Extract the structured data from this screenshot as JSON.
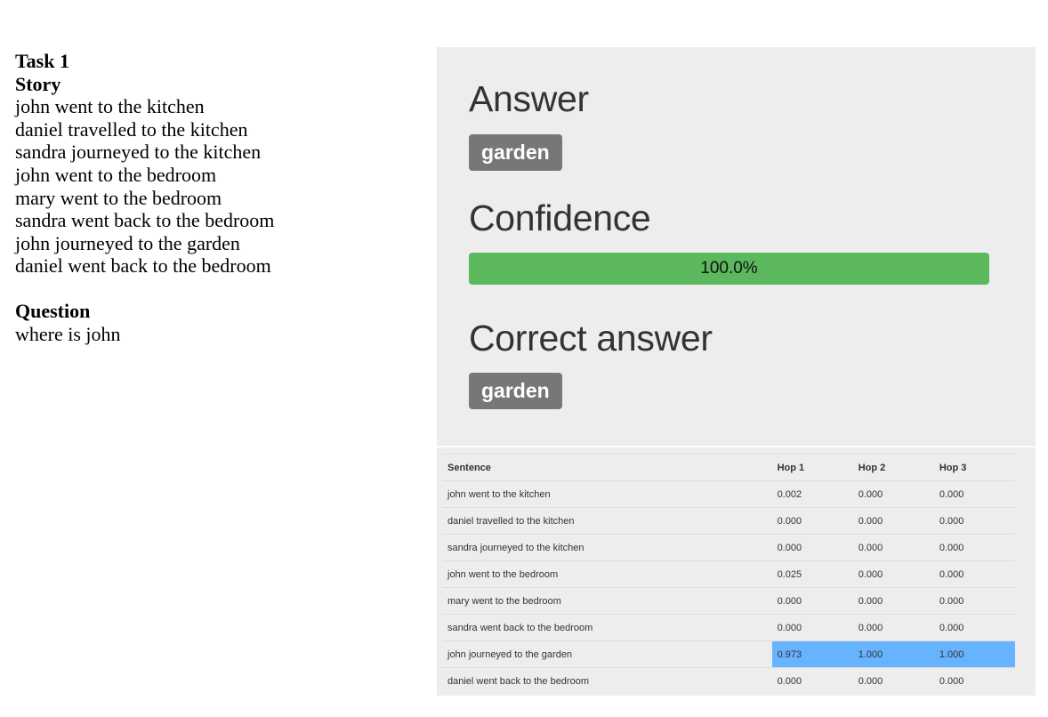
{
  "task": {
    "title": "Task 1",
    "story_heading": "Story",
    "sentences": [
      "john went to the kitchen",
      "daniel travelled to the kitchen",
      "sandra journeyed to the kitchen",
      "john went to the bedroom",
      "mary went to the bedroom",
      "sandra went back to the bedroom",
      "john journeyed to the garden",
      "daniel went back to the bedroom"
    ],
    "question_heading": "Question",
    "question": "where is john"
  },
  "result": {
    "answer_heading": "Answer",
    "answer": "garden",
    "confidence_heading": "Confidence",
    "confidence_text": "100.0%",
    "confidence_value": 100.0,
    "correct_heading": "Correct answer",
    "correct_answer": "garden"
  },
  "colors": {
    "progress": "#5cb85c",
    "highlight": "#66b3ff",
    "badge": "#777777"
  },
  "table": {
    "headers": [
      "Sentence",
      "Hop 1",
      "Hop 2",
      "Hop 3"
    ],
    "rows": [
      {
        "sentence": "john went to the kitchen",
        "hop1": "0.002",
        "hop2": "0.000",
        "hop3": "0.000",
        "highlight": false
      },
      {
        "sentence": "daniel travelled to the kitchen",
        "hop1": "0.000",
        "hop2": "0.000",
        "hop3": "0.000",
        "highlight": false
      },
      {
        "sentence": "sandra journeyed to the kitchen",
        "hop1": "0.000",
        "hop2": "0.000",
        "hop3": "0.000",
        "highlight": false
      },
      {
        "sentence": "john went to the bedroom",
        "hop1": "0.025",
        "hop2": "0.000",
        "hop3": "0.000",
        "highlight": false
      },
      {
        "sentence": "mary went to the bedroom",
        "hop1": "0.000",
        "hop2": "0.000",
        "hop3": "0.000",
        "highlight": false
      },
      {
        "sentence": "sandra went back to the bedroom",
        "hop1": "0.000",
        "hop2": "0.000",
        "hop3": "0.000",
        "highlight": false
      },
      {
        "sentence": "john journeyed to the garden",
        "hop1": "0.973",
        "hop2": "1.000",
        "hop3": "1.000",
        "highlight": true
      },
      {
        "sentence": "daniel went back to the bedroom",
        "hop1": "0.000",
        "hop2": "0.000",
        "hop3": "0.000",
        "highlight": false
      }
    ]
  }
}
